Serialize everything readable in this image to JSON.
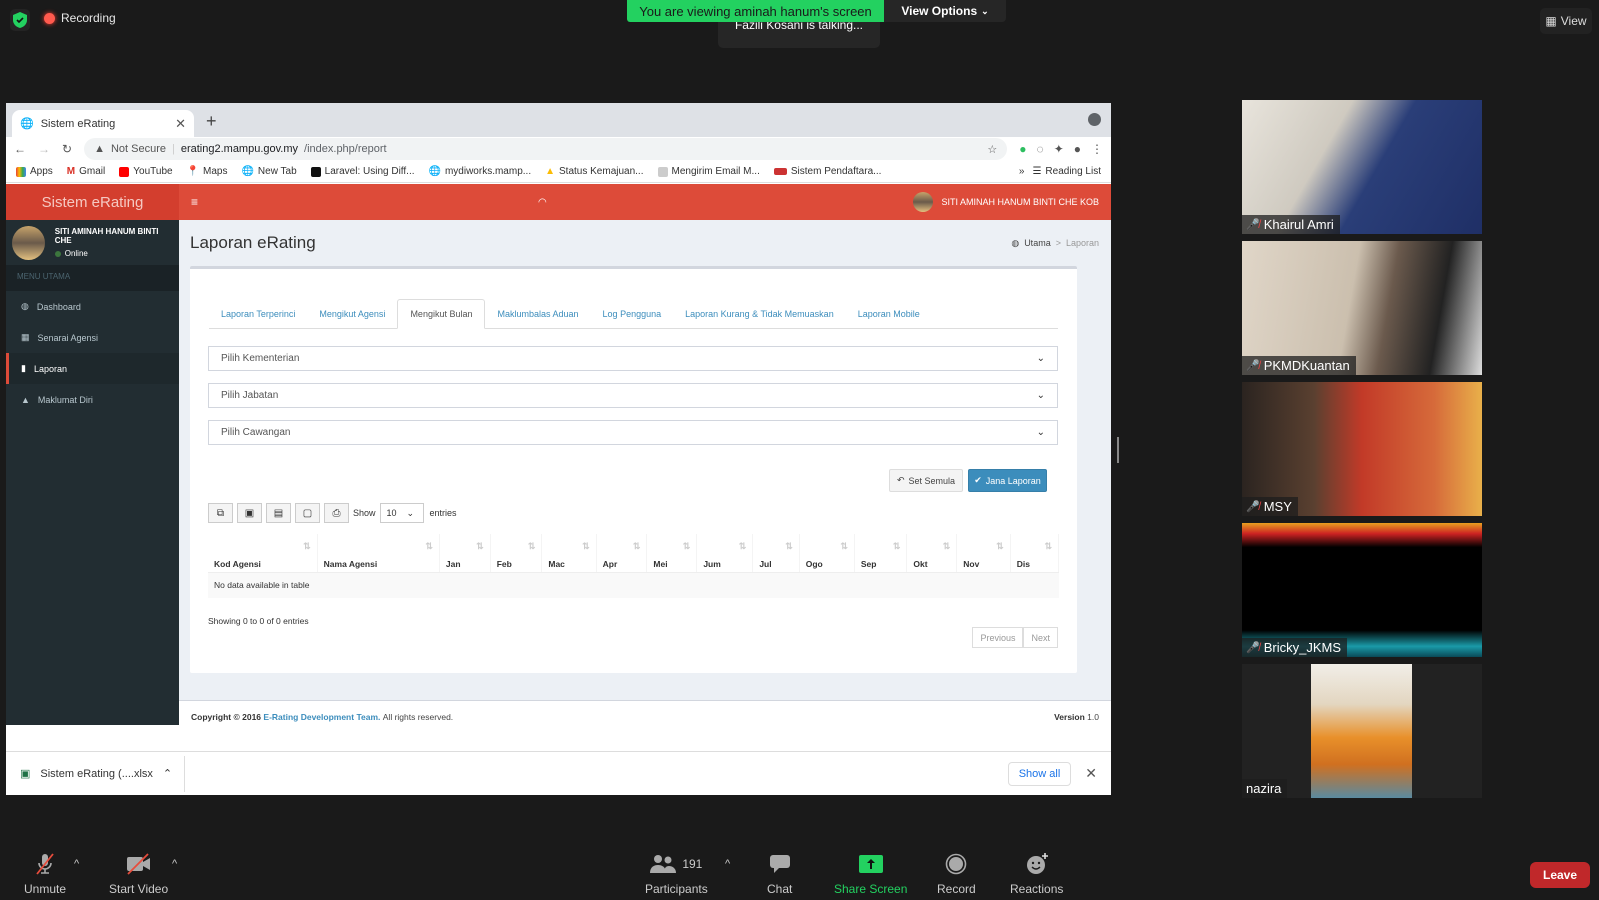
{
  "zoom": {
    "recording_label": "Recording",
    "viewing_banner": "You are viewing aminah hanum's screen",
    "view_options_label": "View Options",
    "talking_indicator": "Fazili Kosani is talking...",
    "view_label": "View",
    "toolbar": {
      "unmute": "Unmute",
      "start_video": "Start Video",
      "participants": "Participants",
      "participants_count": "191",
      "chat": "Chat",
      "share_screen": "Share Screen",
      "record": "Record",
      "reactions": "Reactions",
      "leave": "Leave"
    },
    "participants": [
      {
        "name": "Khairul Amri",
        "muted": true
      },
      {
        "name": "PKMDKuantan",
        "muted": true
      },
      {
        "name": "MSY",
        "muted": true
      },
      {
        "name": "Bricky_JKMS",
        "muted": true
      },
      {
        "name": "nazira",
        "muted": false
      }
    ],
    "colors": {
      "green": "#23d160",
      "leave_red": "#c0282a"
    }
  },
  "browser": {
    "tab_title": "Sistem eRating",
    "security_label": "Not Secure",
    "url_host": "erating2.mampu.gov.my",
    "url_path": "/index.php/report",
    "bookmarks": [
      "Apps",
      "Gmail",
      "YouTube",
      "Maps",
      "New Tab",
      "Laravel: Using Diff...",
      "mydiworks.mamp...",
      "Status Kemajuan...",
      "Mengirim Email M...",
      "Sistem Pendaftara..."
    ],
    "reading_list": "Reading List",
    "download_file": "Sistem eRating (....xlsx",
    "show_all": "Show all"
  },
  "app": {
    "logo": "Sistem eRating",
    "user_name_top": "SITI AMINAH HANUM BINTI CHE KOB",
    "user_name_side": "SITI AMINAH HANUM BINTI CHE",
    "user_status": "Online",
    "menu_header": "MENU UTAMA",
    "menu": [
      {
        "label": "Dashboard",
        "icon": "dashboard-icon"
      },
      {
        "label": "Senarai Agensi",
        "icon": "grid-icon"
      },
      {
        "label": "Laporan",
        "icon": "bar-chart-icon",
        "active": true
      },
      {
        "label": "Maklumat Diri",
        "icon": "user-icon"
      }
    ],
    "page_title": "Laporan eRating",
    "breadcrumb": [
      "Utama",
      "Laporan"
    ],
    "tabs": [
      "Laporan Terperinci",
      "Mengikut Agensi",
      "Mengikut Bulan",
      "Maklumbalas Aduan",
      "Log Pengguna",
      "Laporan Kurang & Tidak Memuaskan",
      "Laporan Mobile"
    ],
    "active_tab": "Mengikut Bulan",
    "selects": {
      "kementerian": "Pilih Kementerian",
      "jabatan": "Pilih Jabatan",
      "cawangan": "Pilih Cawangan"
    },
    "reset_button": "Set Semula",
    "generate_button": "Jana Laporan",
    "show_label": "Show",
    "page_length": "10",
    "entries_label": "entries",
    "table": {
      "columns": [
        "Kod Agensi",
        "Nama Agensi",
        "Jan",
        "Feb",
        "Mac",
        "Apr",
        "Mei",
        "Jum",
        "Jul",
        "Ogo",
        "Sep",
        "Okt",
        "Nov",
        "Dis"
      ],
      "empty_message": "No data available in table"
    },
    "info": "Showing 0 to 0 of 0 entries",
    "previous": "Previous",
    "next": "Next",
    "footer": {
      "copyright": "Copyright © 2016",
      "team": "E-Rating Development Team.",
      "rights": "All rights reserved.",
      "version_label": "Version",
      "version": "1.0"
    },
    "colors": {
      "header_red": "#dd4b39",
      "sidebar": "#222d32",
      "primary": "#3c8dbc"
    }
  }
}
